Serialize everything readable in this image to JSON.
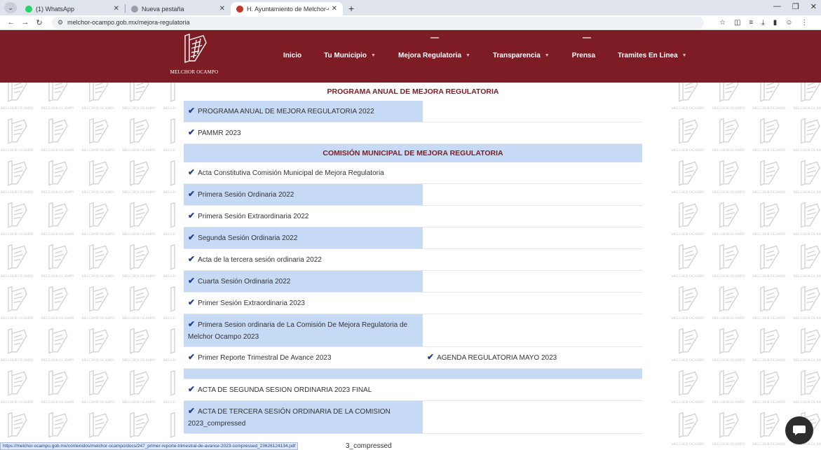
{
  "browser": {
    "tabs": [
      {
        "title": "(1) WhatsApp",
        "favicon_color": "#25d366"
      },
      {
        "title": "Nueva pestaña",
        "favicon_color": "#9aa0aa"
      },
      {
        "title": "H. Ayuntamiento de Melchor-O",
        "favicon_color": "#c0392b"
      }
    ],
    "new_tab": "+",
    "url": "melchor-ocampo.gob.mx/mejora-regulatoria"
  },
  "header": {
    "logo_text": "MELCHOR OCAMPO",
    "nav": [
      {
        "label": "Inicio",
        "caret": false,
        "bar": false
      },
      {
        "label": "Tu Municipio",
        "caret": true,
        "bar": false
      },
      {
        "label": "Mejora Regulatoria",
        "caret": true,
        "bar": true
      },
      {
        "label": "Transparencia",
        "caret": true,
        "bar": false
      },
      {
        "label": "Prensa",
        "caret": false,
        "bar": true
      },
      {
        "label": "Tramites En Linea",
        "caret": true,
        "bar": false
      }
    ]
  },
  "pattern_text": "MELCHOR OCAMPO",
  "content": {
    "section1_title": "PROGRAMA ANUAL DE MEJORA REGULATORIA",
    "section2_title": "COMISIÓN MUNICIPAL DE MEJORA REGULATORIA",
    "rows1": [
      {
        "left": "PROGRAMA ANUAL DE MEJORA REGULATORIA 2022",
        "right": "",
        "blue": true
      },
      {
        "left": "PAMMR 2023",
        "right": "",
        "blue": false
      }
    ],
    "rows2": [
      {
        "left": "Acta Constitutiva Comisión Municipal de Mejora Regulatoria",
        "right": "",
        "blue": false
      },
      {
        "left": "Primera Sesión Ordinaria 2022",
        "right": "",
        "blue": true
      },
      {
        "left": "Primera Sesión Extraordinaria 2022",
        "right": "",
        "blue": false
      },
      {
        "left": "Segunda Sesión Ordinaria 2022",
        "right": "",
        "blue": true
      },
      {
        "left": "Acta de la tercera sesión ordinaria 2022",
        "right": "",
        "blue": false
      },
      {
        "left": "Cuarta Sesión Ordinaria 2022",
        "right": "",
        "blue": true
      },
      {
        "left": "Primer Sesión Extraordinaria 2023",
        "right": "",
        "blue": false
      },
      {
        "left": "Primera Sesion ordinaria de La Comisión De Mejora Regulatoria de Melchor Ocampo 2023",
        "right": "",
        "blue": true,
        "tall": true
      },
      {
        "left": "Primer Reporte Trimestral De Avance 2023",
        "right": "AGENDA REGULATORIA MAYO 2023",
        "blue": false
      },
      {
        "left": "",
        "right": "",
        "blue": true,
        "spacer": true
      },
      {
        "left": "ACTA DE SEGUNDA SESION ORDINARIA 2023 FINAL",
        "right": "",
        "blue": false
      },
      {
        "left": "ACTA DE TERCERA SESIÓN ORDINARIA DE LA COMISION 2023_compressed",
        "right": "",
        "blue": true,
        "tall": true
      }
    ]
  },
  "status_url": "https://melchor-ocampo.gob.mx/contenidos/melchor-ocampo/docs/247_primer-reporte-trimestral-de-avance-2023-compressed_23626124134.pdf",
  "partial_text": "3_compressed"
}
